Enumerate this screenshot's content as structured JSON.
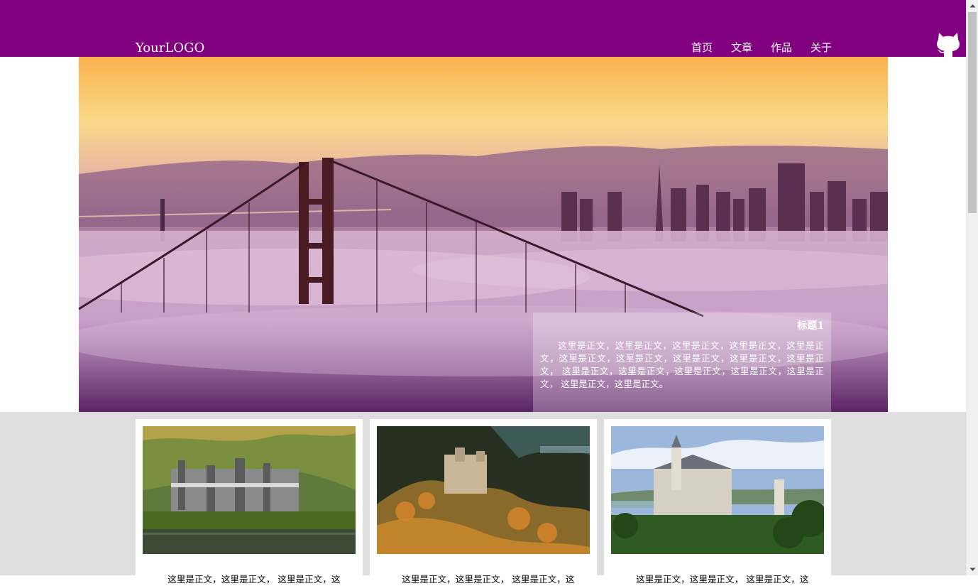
{
  "header": {
    "logo": "YourLOGO",
    "nav": [
      "首页",
      "文章",
      "作品",
      "关于"
    ],
    "github_icon": "github-octocat-icon",
    "background": "#800080"
  },
  "banner": {
    "image": "golden-gate-bridge-in-fog-at-sunset",
    "caption": {
      "title": "标题1",
      "body": "这里是正文，这里是正文，这里是正文，这里是正文，这里是正文，这里是正文，这里是正文，这里是正文，这里是正文，这里是正文， 这里是正文，这里是正文，这里是正文，这里是正文，这里是正文， 这里是正文，这里是正文。"
    }
  },
  "cards": [
    {
      "image": "castle-by-lake-photo",
      "text": "这里是正文，这里是正文， 这里是正文，这"
    },
    {
      "image": "hilltop-castle-autumn-photo",
      "text": "这里是正文，这里是正文， 这里是正文，这"
    },
    {
      "image": "white-castle-blue-sky-photo",
      "text": "这里是正文，这里是正文， 这里是正文，这"
    }
  ],
  "colors": {
    "header": "#800080",
    "section_bg": "#dedede",
    "caption_bg": "rgba(255,255,255,0.28)"
  }
}
